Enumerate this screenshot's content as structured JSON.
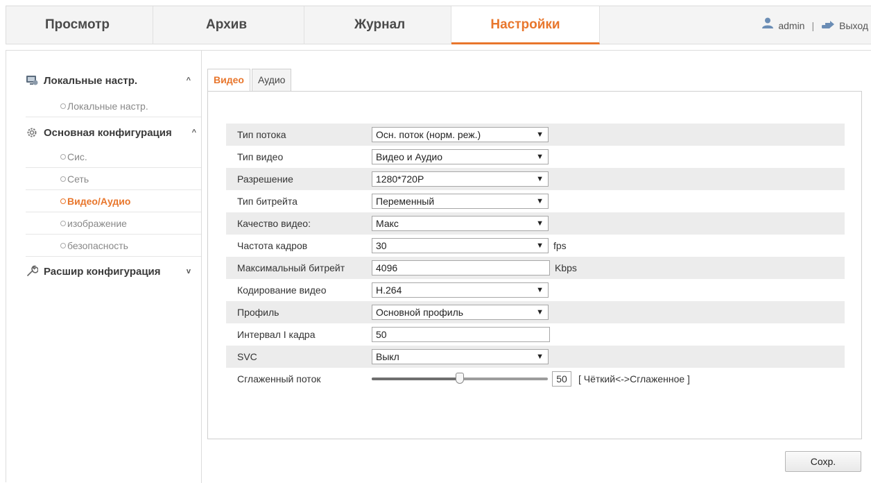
{
  "nav": {
    "tabs": [
      "Просмотр",
      "Архив",
      "Журнал",
      "Настройки"
    ],
    "active_tab": "Настройки",
    "user": "admin",
    "separator": "|",
    "logout": "Выход"
  },
  "sidebar": {
    "sections": [
      {
        "label": "Локальные настр.",
        "icon": "monitor-icon",
        "chevron": "^",
        "items": [
          "Локальные настр."
        ]
      },
      {
        "label": "Основная конфигурация",
        "icon": "gear-icon",
        "chevron": "^",
        "items": [
          "Сис.",
          "Сеть",
          "Видео/Аудио",
          "изображение",
          "безопасность"
        ]
      },
      {
        "label": "Расшир конфигурация",
        "icon": "wrench-icon",
        "chevron": "v",
        "items": []
      }
    ],
    "active_item": "Видео/Аудио"
  },
  "subtabs": [
    "Видео",
    "Аудио"
  ],
  "active_subtab": "Видео",
  "form": {
    "rows": [
      {
        "label": "Тип потока",
        "type": "select",
        "value": "Осн. поток (норм. реж.)"
      },
      {
        "label": "Тип видео",
        "type": "select",
        "value": "Видео и Аудио"
      },
      {
        "label": "Разрешение",
        "type": "select",
        "value": "1280*720P"
      },
      {
        "label": "Тип битрейта",
        "type": "select",
        "value": "Переменный"
      },
      {
        "label": "Качество видео:",
        "type": "select",
        "value": "Макс"
      },
      {
        "label": "Частота кадров",
        "type": "select",
        "value": "30",
        "unit": "fps"
      },
      {
        "label": "Максимальный битрейт",
        "type": "input",
        "value": "4096",
        "unit": "Kbps"
      },
      {
        "label": "Кодирование видео",
        "type": "select",
        "value": "H.264"
      },
      {
        "label": "Профиль",
        "type": "select",
        "value": "Основной профиль"
      },
      {
        "label": "Интервал I кадра",
        "type": "input",
        "value": "50"
      },
      {
        "label": "SVC",
        "type": "select",
        "value": "Выкл"
      },
      {
        "label": "Сглаженный поток",
        "type": "slider",
        "value": "50",
        "level": 0.5,
        "range": "[ Чёткий<->Сглаженное ]"
      }
    ]
  },
  "save_label": "Сохр."
}
